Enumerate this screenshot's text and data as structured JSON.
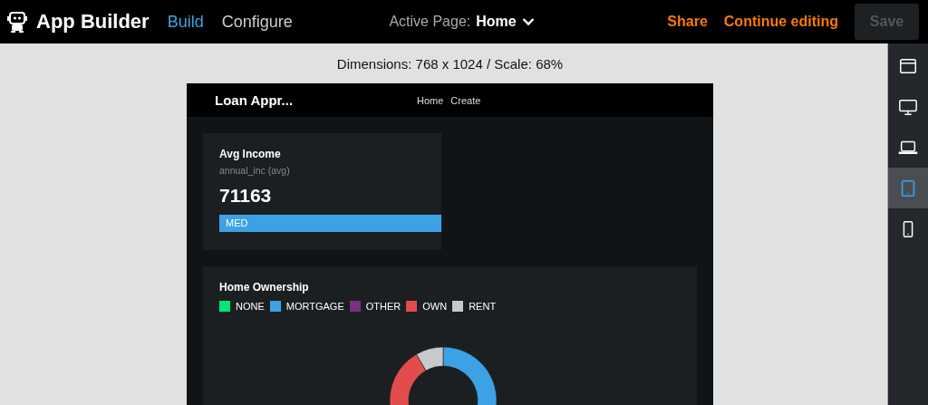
{
  "topbar": {
    "title": "App Builder",
    "tabs": [
      {
        "label": "Build",
        "selected": true
      },
      {
        "label": "Configure",
        "selected": false
      }
    ],
    "active_page": {
      "label": "Active Page:",
      "value": "Home"
    },
    "links": [
      "Share",
      "Continue editing"
    ],
    "save_button": {
      "label": "Save",
      "disabled": true
    }
  },
  "canvas": {
    "dimensions": "Dimensions: 768 x 1024 / Scale: 68%"
  },
  "preview": {
    "app_title": "Loan Appr...",
    "nav": [
      "Home",
      "Create"
    ],
    "metric_card": {
      "title": "Avg Income",
      "subtitle": "annual_inc (avg)",
      "value": "71163",
      "band": "MED"
    },
    "chart_card": {
      "title": "Home Ownership",
      "legend": [
        {
          "label": "NONE",
          "color": "#00e676"
        },
        {
          "label": "MORTGAGE",
          "color": "#3ca2e5"
        },
        {
          "label": "OTHER",
          "color": "#7b2f7e"
        },
        {
          "label": "OWN",
          "color": "#e24c4c"
        },
        {
          "label": "RENT",
          "color": "#c8c9cb"
        }
      ]
    }
  },
  "device_rail": [
    {
      "kind": "browser",
      "selected": false
    },
    {
      "kind": "desktop",
      "selected": false
    },
    {
      "kind": "laptop",
      "selected": false
    },
    {
      "kind": "tablet",
      "selected": true
    },
    {
      "kind": "phone",
      "selected": false
    }
  ]
}
